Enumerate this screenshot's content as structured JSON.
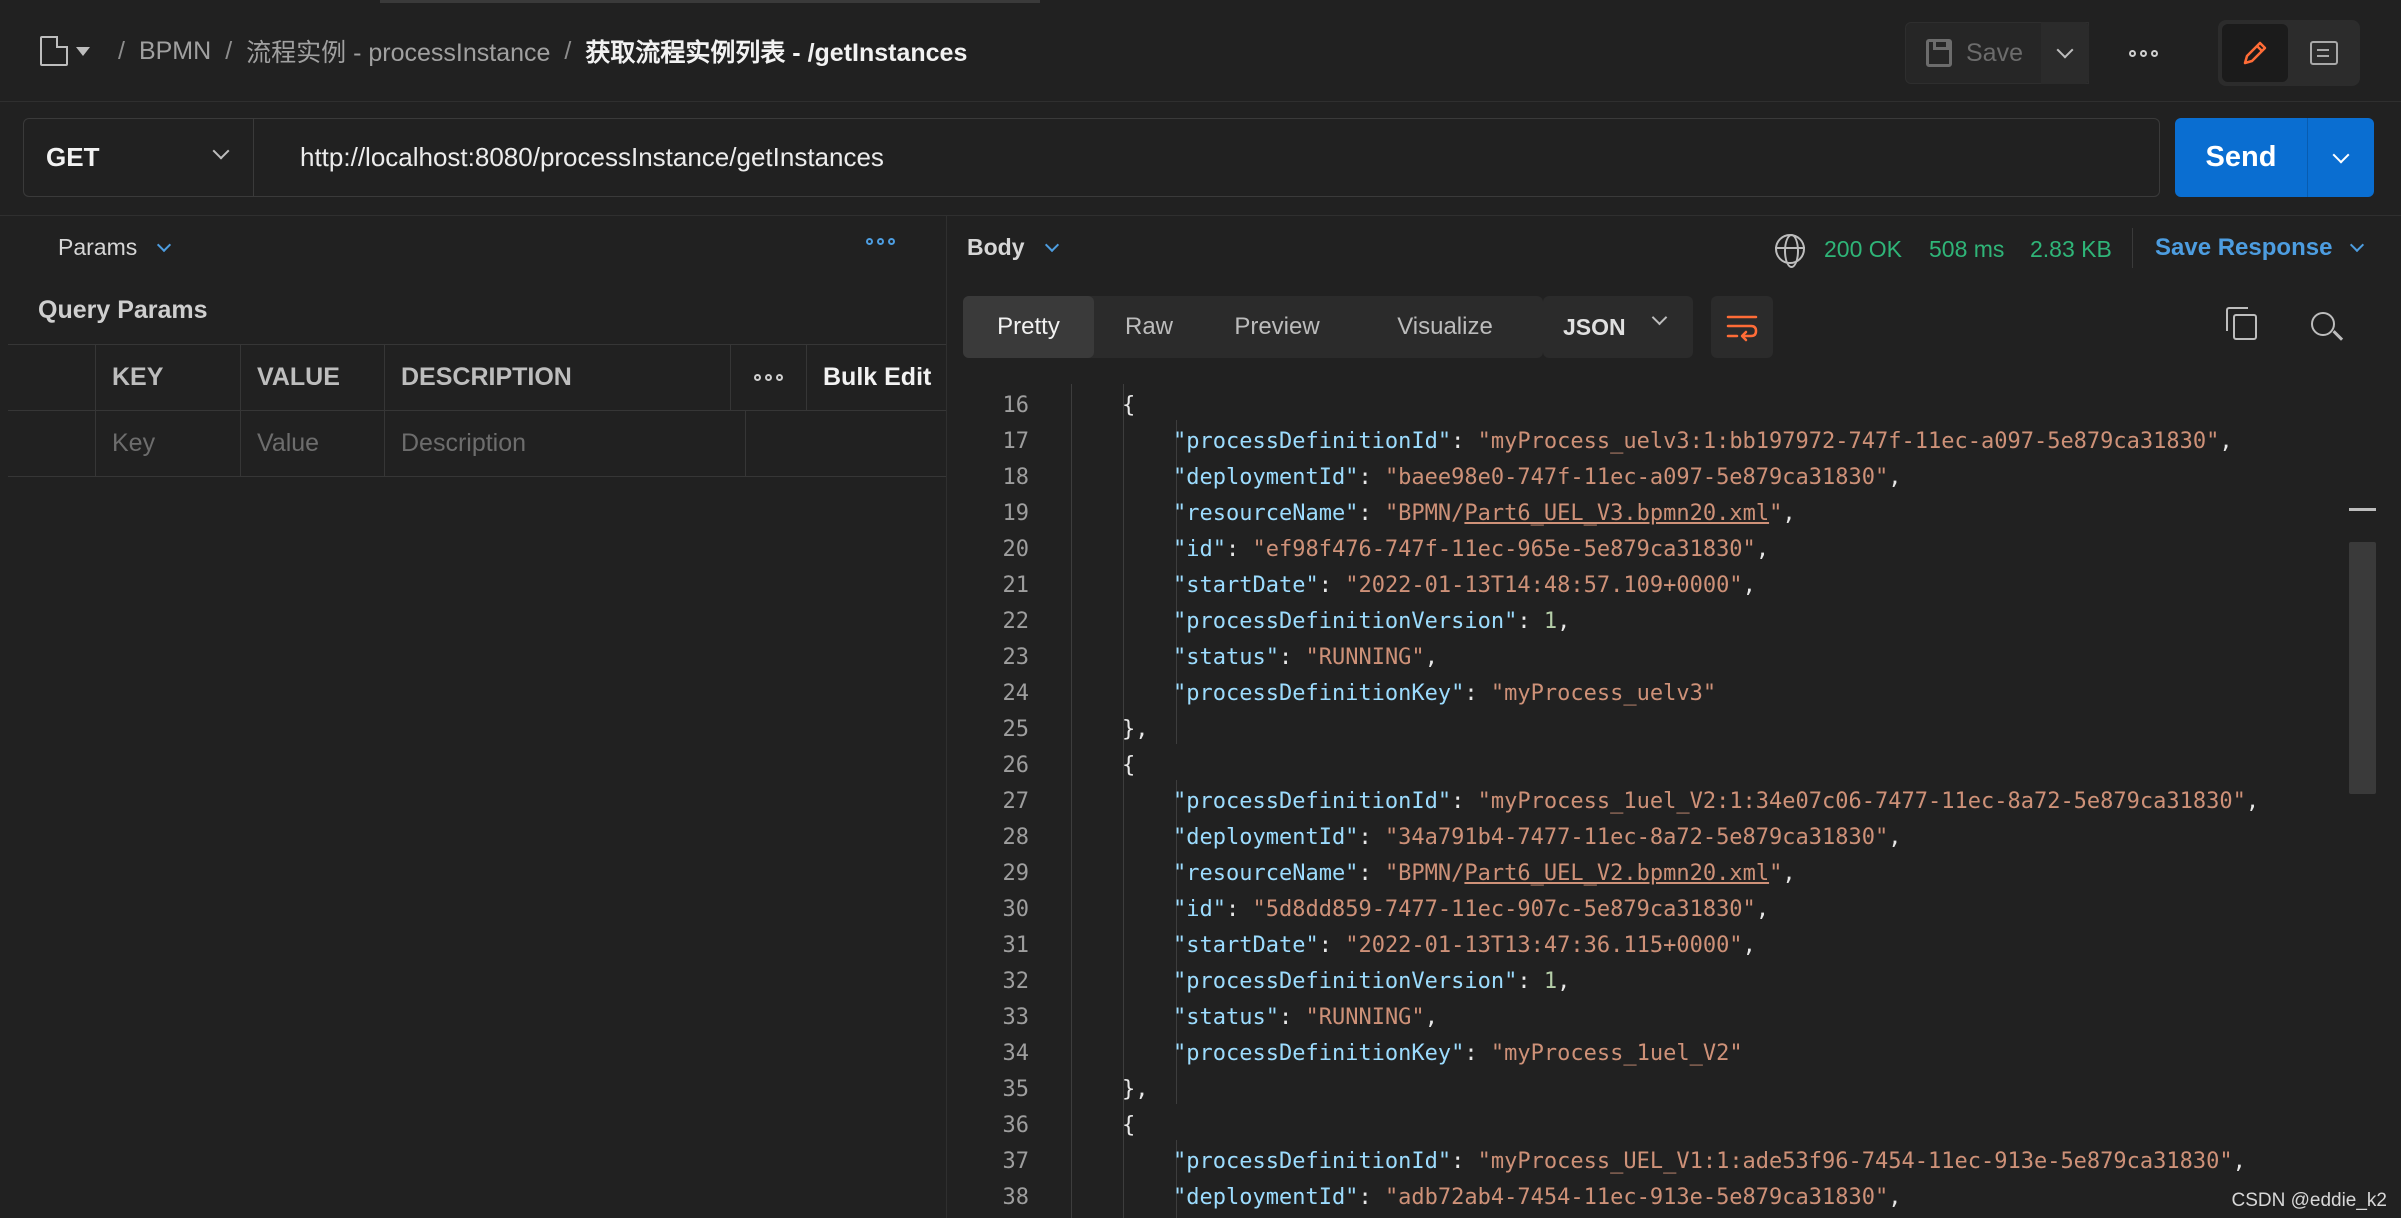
{
  "header": {
    "breadcrumb": [
      "BPMN",
      "流程实例 - processInstance",
      "获取流程实例列表 - /getInstances"
    ],
    "save_label": "Save"
  },
  "request": {
    "method": "GET",
    "url": "http://localhost:8080/processInstance/getInstances",
    "send_label": "Send"
  },
  "params": {
    "tab_label": "Params",
    "section_title": "Query Params",
    "columns": [
      "KEY",
      "VALUE",
      "DESCRIPTION"
    ],
    "bulk_edit_label": "Bulk Edit",
    "placeholders": [
      "Key",
      "Value",
      "Description"
    ]
  },
  "response": {
    "tab_label": "Body",
    "status": "200 OK",
    "time": "508 ms",
    "size": "2.83 KB",
    "save_response_label": "Save Response",
    "view_tabs": [
      "Pretty",
      "Raw",
      "Preview",
      "Visualize"
    ],
    "active_view": "Pretty",
    "format": "JSON",
    "colors": {
      "status": "#2fb578",
      "accent": "#4d9de0",
      "send": "#0a6ed1"
    }
  },
  "code_lines": [
    {
      "n": "16",
      "t": "{"
    },
    {
      "n": "17",
      "t": "\"processDefinitionId\": \"myProcess_uelv3:1:bb197972-747f-11ec-a097-5e879ca31830\","
    },
    {
      "n": "18",
      "t": "\"deploymentId\": \"baee98e0-747f-11ec-a097-5e879ca31830\","
    },
    {
      "n": "19",
      "t": "\"resourceName\": \"BPMN/Part6_UEL_V3.bpmn20.xml\","
    },
    {
      "n": "20",
      "t": "\"id\": \"ef98f476-747f-11ec-965e-5e879ca31830\","
    },
    {
      "n": "21",
      "t": "\"startDate\": \"2022-01-13T14:48:57.109+0000\","
    },
    {
      "n": "22",
      "t": "\"processDefinitionVersion\": 1,"
    },
    {
      "n": "23",
      "t": "\"status\": \"RUNNING\","
    },
    {
      "n": "24",
      "t": "\"processDefinitionKey\": \"myProcess_uelv3\""
    },
    {
      "n": "25",
      "t": "},"
    },
    {
      "n": "26",
      "t": "{"
    },
    {
      "n": "27",
      "t": "\"processDefinitionId\": \"myProcess_1uel_V2:1:34e07c06-7477-11ec-8a72-5e879ca31830\","
    },
    {
      "n": "28",
      "t": "\"deploymentId\": \"34a791b4-7477-11ec-8a72-5e879ca31830\","
    },
    {
      "n": "29",
      "t": "\"resourceName\": \"BPMN/Part6_UEL_V2.bpmn20.xml\","
    },
    {
      "n": "30",
      "t": "\"id\": \"5d8dd859-7477-11ec-907c-5e879ca31830\","
    },
    {
      "n": "31",
      "t": "\"startDate\": \"2022-01-13T13:47:36.115+0000\","
    },
    {
      "n": "32",
      "t": "\"processDefinitionVersion\": 1,"
    },
    {
      "n": "33",
      "t": "\"status\": \"RUNNING\","
    },
    {
      "n": "34",
      "t": "\"processDefinitionKey\": \"myProcess_1uel_V2\""
    },
    {
      "n": "35",
      "t": "},"
    },
    {
      "n": "36",
      "t": "{"
    },
    {
      "n": "37",
      "t": "\"processDefinitionId\": \"myProcess_UEL_V1:1:ade53f96-7454-11ec-913e-5e879ca31830\","
    },
    {
      "n": "38",
      "t": "\"deploymentId\": \"adb72ab4-7454-11ec-913e-5e879ca31830\","
    }
  ],
  "watermark": "CSDN @eddie_k2"
}
